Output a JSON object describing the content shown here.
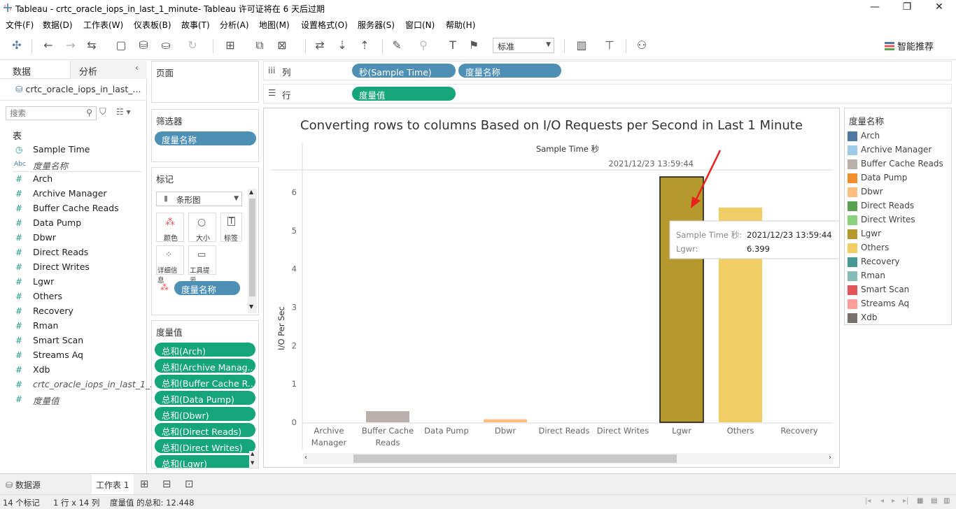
{
  "titlebar": {
    "title": "Tableau - crtc_oracle_iops_in_last_1_minute- Tableau 许可证将在 6 天后过期",
    "controls": [
      "—",
      "❐",
      "✕"
    ]
  },
  "menubar": [
    "文件(F)",
    "数据(D)",
    "工作表(W)",
    "仪表板(B)",
    "故事(T)",
    "分析(A)",
    "地图(M)",
    "设置格式(O)",
    "服务器(S)",
    "窗口(N)",
    "帮助(H)"
  ],
  "toolbar": {
    "fit_value": "标准",
    "smart_label": "智能推荐"
  },
  "datapane": {
    "tab_data": "数据",
    "tab_analysis": "分析",
    "datasource": "crtc_oracle_iops_in_last_...",
    "search_placeholder": "搜索",
    "table_header": "表",
    "fields": [
      {
        "type": "date",
        "name": "Sample Time"
      },
      {
        "type": "Abc",
        "name": "度量名称",
        "italic": true
      },
      {
        "type": "#",
        "name": "Arch"
      },
      {
        "type": "#",
        "name": "Archive Manager"
      },
      {
        "type": "#",
        "name": "Buffer Cache Reads"
      },
      {
        "type": "#",
        "name": "Data Pump"
      },
      {
        "type": "#",
        "name": "Dbwr"
      },
      {
        "type": "#",
        "name": "Direct Reads"
      },
      {
        "type": "#",
        "name": "Direct Writes"
      },
      {
        "type": "#",
        "name": "Lgwr"
      },
      {
        "type": "#",
        "name": "Others"
      },
      {
        "type": "#",
        "name": "Recovery"
      },
      {
        "type": "#",
        "name": "Rman"
      },
      {
        "type": "#",
        "name": "Smart Scan"
      },
      {
        "type": "#",
        "name": "Streams Aq"
      },
      {
        "type": "#",
        "name": "Xdb"
      },
      {
        "type": "#",
        "name": "crtc_oracle_iops_in_last_1_...",
        "italic": true
      },
      {
        "type": "#",
        "name": "度量值",
        "italic": true
      }
    ]
  },
  "shelves": {
    "pages": "页面",
    "filters": "筛选器",
    "filter_pill": "度量名称",
    "marks": "标记",
    "mark_type": "条形图",
    "mark_buttons": [
      "颜色",
      "大小",
      "标签",
      "详细信息",
      "工具提示"
    ],
    "marks_pill": "度量名称",
    "columns_label": "列",
    "rows_label": "行",
    "columns_pills": [
      "秒(Sample Time)",
      "度量名称"
    ],
    "rows_pills": [
      "度量值"
    ],
    "measure_values": "度量值",
    "measure_pills": [
      "总和(Arch)",
      "总和(Archive Manag..",
      "总和(Buffer Cache R..",
      "总和(Data Pump)",
      "总和(Dbwr)",
      "总和(Direct Reads)",
      "总和(Direct Writes)",
      "总和(Lgwr)"
    ]
  },
  "chart_data": {
    "type": "bar",
    "title": "Converting rows to columns Based on I/O Requests per Second in Last 1 Minute",
    "column_header": "Sample Time 秒",
    "column_value": "2021/12/23 13:59:44",
    "ylabel": "I/O Per Sec",
    "ylim": [
      0,
      6.6
    ],
    "yticks": [
      0,
      1,
      2,
      3,
      4,
      5,
      6
    ],
    "categories": [
      "Archive Manager",
      "Buffer Cache Reads",
      "Data Pump",
      "Dbwr",
      "Direct Reads",
      "Direct Writes",
      "Lgwr",
      "Others",
      "Recovery"
    ],
    "category_lines": [
      [
        "Archive",
        "Manager"
      ],
      [
        "Buffer Cache",
        "Reads"
      ],
      [
        "Data Pump"
      ],
      [
        "Dbwr"
      ],
      [
        "Direct Reads"
      ],
      [
        "Direct Writes"
      ],
      [
        "Lgwr"
      ],
      [
        "Others"
      ],
      [
        "Recovery"
      ]
    ],
    "values": [
      0,
      0.29,
      0,
      0.08,
      0,
      0,
      6.399,
      5.6,
      0
    ],
    "colors": [
      "#a0cbe8",
      "#bab0ac",
      "#f28e2b",
      "#ffbe7d",
      "#59a14f",
      "#8cd17d",
      "#b6992d",
      "#f1ce63",
      "#499894"
    ],
    "tooltip": {
      "label1": "Sample Time 秒:",
      "value1": "2021/12/23 13:59:44",
      "label2": "Lgwr:",
      "value2": "6.399"
    }
  },
  "legend": {
    "title": "度量名称",
    "items": [
      {
        "name": "Arch",
        "color": "#4e79a7"
      },
      {
        "name": "Archive Manager",
        "color": "#a0cbe8"
      },
      {
        "name": "Buffer Cache Reads",
        "color": "#bab0ac"
      },
      {
        "name": "Data Pump",
        "color": "#f28e2b"
      },
      {
        "name": "Dbwr",
        "color": "#ffbe7d"
      },
      {
        "name": "Direct Reads",
        "color": "#59a14f"
      },
      {
        "name": "Direct Writes",
        "color": "#8cd17d"
      },
      {
        "name": "Lgwr",
        "color": "#b6992d"
      },
      {
        "name": "Others",
        "color": "#f1ce63"
      },
      {
        "name": "Recovery",
        "color": "#499894"
      },
      {
        "name": "Rman",
        "color": "#86bcb6"
      },
      {
        "name": "Smart Scan",
        "color": "#e15759"
      },
      {
        "name": "Streams Aq",
        "color": "#ff9d9a"
      },
      {
        "name": "Xdb",
        "color": "#79706e"
      }
    ]
  },
  "bottom_tabs": {
    "datasource": "数据源",
    "sheet": "工作表 1"
  },
  "status": {
    "marks": "14 个标记",
    "rows_cols": "1 行 x 14 列",
    "sum": "度量值 的总和: 12.448"
  }
}
